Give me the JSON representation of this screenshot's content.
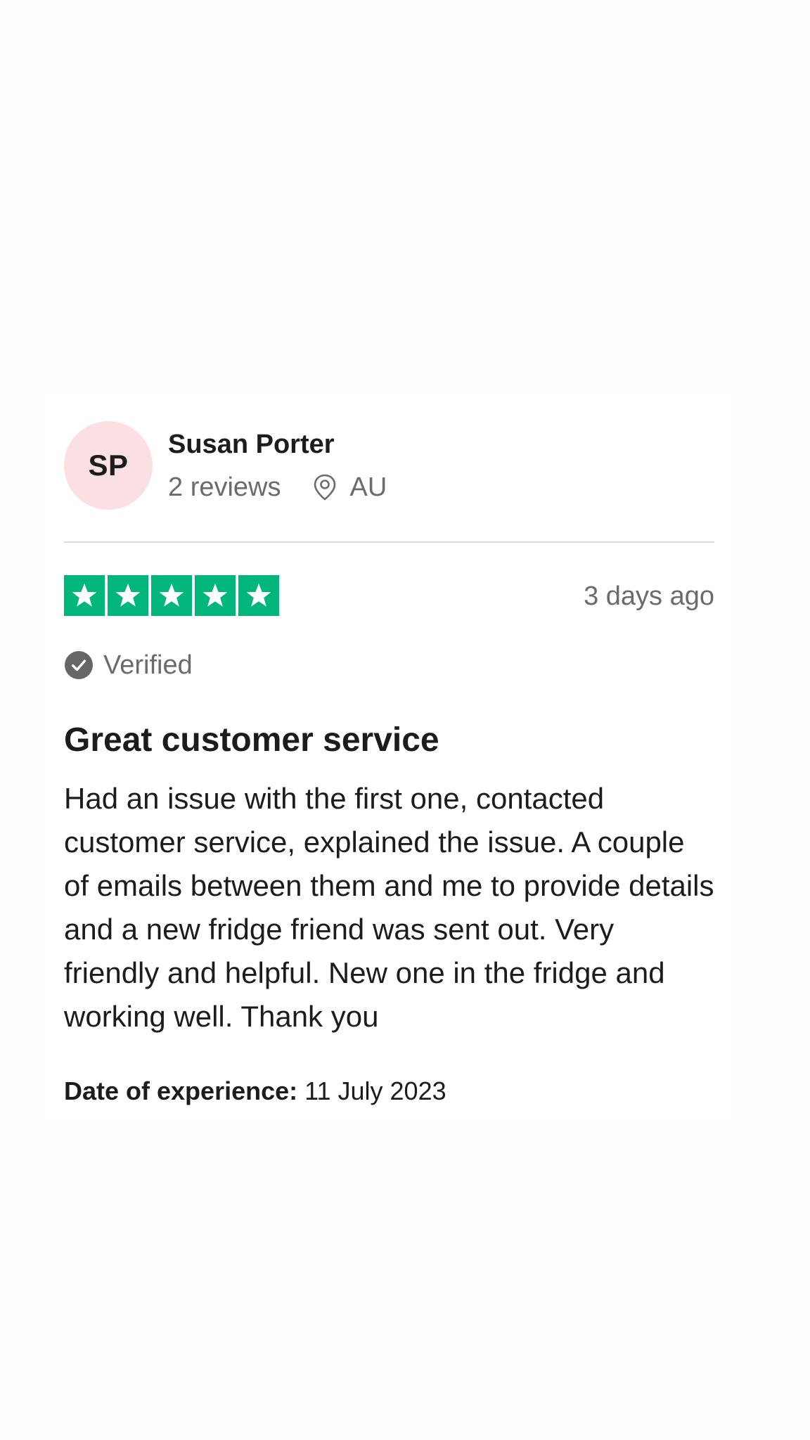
{
  "review": {
    "reviewer": {
      "initials": "SP",
      "name": "Susan Porter",
      "review_count": "2 reviews",
      "location": "AU",
      "avatar_color": "#fadfe3"
    },
    "rating": {
      "stars": 5,
      "max_stars": 5,
      "color": "#00b67a"
    },
    "date_ago": "3 days ago",
    "verified_label": "Verified",
    "title": "Great customer service",
    "body": "Had an issue with the first one, contacted customer service, explained the issue. A couple of emails between them and me to provide details and a new fridge friend was sent out. Very friendly and helpful. New one in the fridge and working well. Thank you",
    "experience": {
      "label": "Date of experience:",
      "value": "11 July 2023"
    }
  },
  "icons": {
    "location": "map-pin-icon",
    "verified": "check-circle-icon",
    "star": "star-icon"
  }
}
